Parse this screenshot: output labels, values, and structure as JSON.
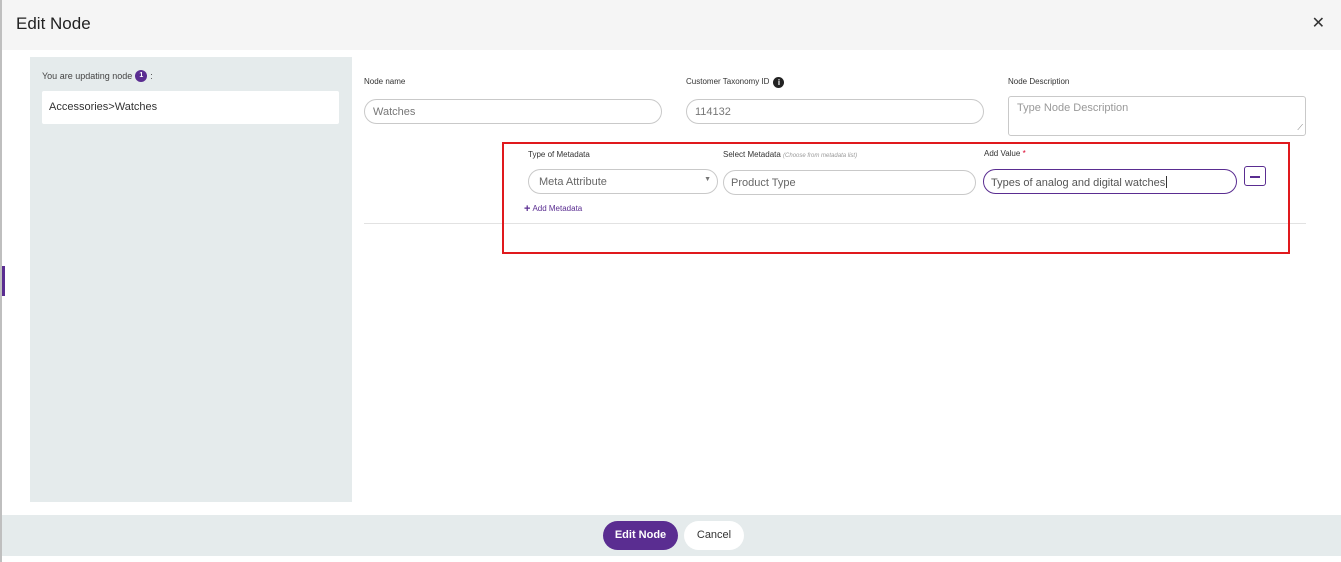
{
  "modal": {
    "title": "Edit Node",
    "close_glyph": "✕"
  },
  "sidebar": {
    "updating_text": "You are updating node",
    "count_badge": "1",
    "colon": ":",
    "path": "Accessories>Watches"
  },
  "form": {
    "node_name": {
      "label": "Node name",
      "value": "Watches"
    },
    "customer_taxonomy_id": {
      "label": "Customer Taxonomy ID",
      "value": "114132",
      "info_glyph": "i"
    },
    "node_description": {
      "label": "Node Description",
      "placeholder": "Type Node Description"
    }
  },
  "metadata": {
    "type_label": "Type of Metadata",
    "select_label": "Select Metadata",
    "select_hint": "(Choose from metadata list)",
    "value_label": "Add Value",
    "required_mark": "*",
    "rows": [
      {
        "type": "Meta Attribute",
        "metadata": "Product Type",
        "value": "Types of analog and digital watches"
      }
    ],
    "add_label": "Add Metadata",
    "add_glyph": "+",
    "dropdown_glyph": "▼"
  },
  "footer": {
    "primary_label": "Edit Node",
    "secondary_label": "Cancel"
  },
  "colors": {
    "accent": "#5a2d91",
    "highlight": "#e0191d",
    "panel": "#e5ebec"
  }
}
